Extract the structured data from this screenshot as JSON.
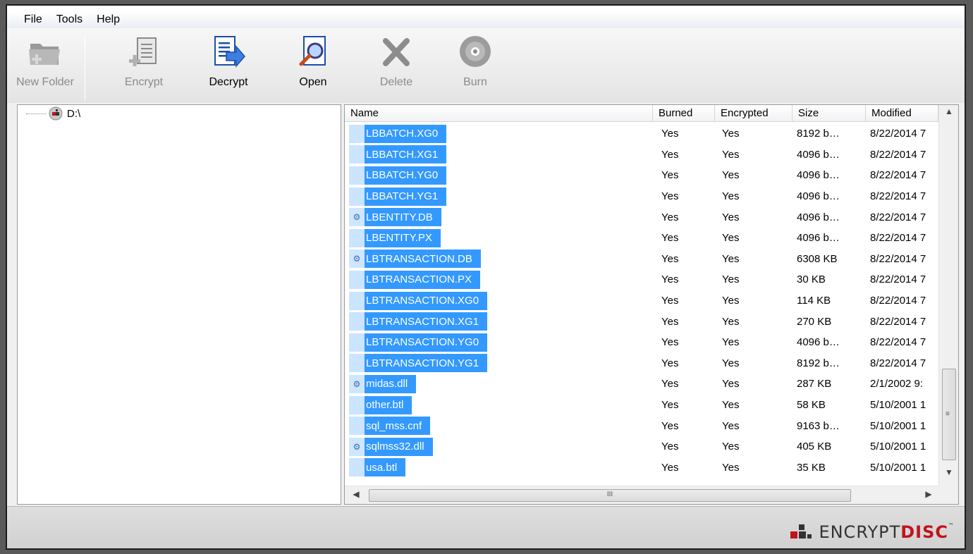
{
  "menu": [
    "File",
    "Tools",
    "Help"
  ],
  "toolbar": {
    "new_folder": "New Folder",
    "encrypt": "Encrypt",
    "decrypt": "Decrypt",
    "open": "Open",
    "delete": "Delete",
    "burn": "Burn"
  },
  "tree": {
    "drive": "D:\\"
  },
  "columns": [
    "Name",
    "Burned",
    "Encrypted",
    "Size",
    "Modified"
  ],
  "files": [
    {
      "name": "LBBATCH.XG0",
      "burned": "Yes",
      "encrypted": "Yes",
      "size": "8192 b…",
      "modified": "8/22/2014 7",
      "icon": "file"
    },
    {
      "name": "LBBATCH.XG1",
      "burned": "Yes",
      "encrypted": "Yes",
      "size": "4096 b…",
      "modified": "8/22/2014 7",
      "icon": "file"
    },
    {
      "name": "LBBATCH.YG0",
      "burned": "Yes",
      "encrypted": "Yes",
      "size": "4096 b…",
      "modified": "8/22/2014 7",
      "icon": "file"
    },
    {
      "name": "LBBATCH.YG1",
      "burned": "Yes",
      "encrypted": "Yes",
      "size": "4096 b…",
      "modified": "8/22/2014 7",
      "icon": "file"
    },
    {
      "name": "LBENTITY.DB",
      "burned": "Yes",
      "encrypted": "Yes",
      "size": "4096 b…",
      "modified": "8/22/2014 7",
      "icon": "db"
    },
    {
      "name": "LBENTITY.PX",
      "burned": "Yes",
      "encrypted": "Yes",
      "size": "4096 b…",
      "modified": "8/22/2014 7",
      "icon": "file"
    },
    {
      "name": "LBTRANSACTION.DB",
      "burned": "Yes",
      "encrypted": "Yes",
      "size": "6308 KB",
      "modified": "8/22/2014 7",
      "icon": "db"
    },
    {
      "name": "LBTRANSACTION.PX",
      "burned": "Yes",
      "encrypted": "Yes",
      "size": "30 KB",
      "modified": "8/22/2014 7",
      "icon": "file"
    },
    {
      "name": "LBTRANSACTION.XG0",
      "burned": "Yes",
      "encrypted": "Yes",
      "size": "114 KB",
      "modified": "8/22/2014 7",
      "icon": "file"
    },
    {
      "name": "LBTRANSACTION.XG1",
      "burned": "Yes",
      "encrypted": "Yes",
      "size": "270 KB",
      "modified": "8/22/2014 7",
      "icon": "file"
    },
    {
      "name": "LBTRANSACTION.YG0",
      "burned": "Yes",
      "encrypted": "Yes",
      "size": "4096 b…",
      "modified": "8/22/2014 7",
      "icon": "file"
    },
    {
      "name": "LBTRANSACTION.YG1",
      "burned": "Yes",
      "encrypted": "Yes",
      "size": "8192 b…",
      "modified": "8/22/2014 7",
      "icon": "file"
    },
    {
      "name": "midas.dll",
      "burned": "Yes",
      "encrypted": "Yes",
      "size": "287 KB",
      "modified": "2/1/2002 9:",
      "icon": "db"
    },
    {
      "name": "other.btl",
      "burned": "Yes",
      "encrypted": "Yes",
      "size": "58 KB",
      "modified": "5/10/2001 1",
      "icon": "file"
    },
    {
      "name": "sql_mss.cnf",
      "burned": "Yes",
      "encrypted": "Yes",
      "size": "9163 b…",
      "modified": "5/10/2001 1",
      "icon": "file"
    },
    {
      "name": "sqlmss32.dll",
      "burned": "Yes",
      "encrypted": "Yes",
      "size": "405 KB",
      "modified": "5/10/2001 1",
      "icon": "db"
    },
    {
      "name": "usa.btl",
      "burned": "Yes",
      "encrypted": "Yes",
      "size": "35 KB",
      "modified": "5/10/2001 1",
      "icon": "file"
    }
  ],
  "hscroll_grip": "III",
  "brand": {
    "part1": "ENCRYPT",
    "part2": "DISC",
    "tm": "™"
  },
  "colors": {
    "selection": "#3399ff",
    "brand_red": "#c0141c"
  }
}
